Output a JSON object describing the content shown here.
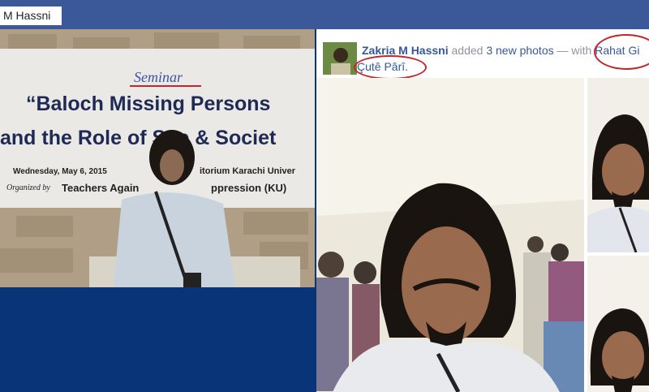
{
  "header": {
    "profile_name": "M Hassni"
  },
  "left_photo": {
    "banner": {
      "eyebrow": "Seminar",
      "title_line1": "“Baloch Missing Persons",
      "title_line2": "and the Role of S   te & Societ",
      "date": "Wednesday, May 6, 2015",
      "venue": "itorium Karachi Univer",
      "organized_label": "Organized by",
      "organizer": "Teachers Again",
      "organizer_tail": "ppression (KU)"
    }
  },
  "post": {
    "author": "Zakria M Hassni",
    "action": "added",
    "photos_count_text": "3 new photos",
    "with_text": "— with",
    "tagged_first": "Rahat Gi",
    "tagged_second": "Çutê Pârî."
  },
  "icons": [
    "avatar-thumbnail"
  ],
  "colors": {
    "header_bg": "#3b5998",
    "page_bg": "#0a3478",
    "link": "#365899",
    "highlight_circle": "#c0272d"
  }
}
